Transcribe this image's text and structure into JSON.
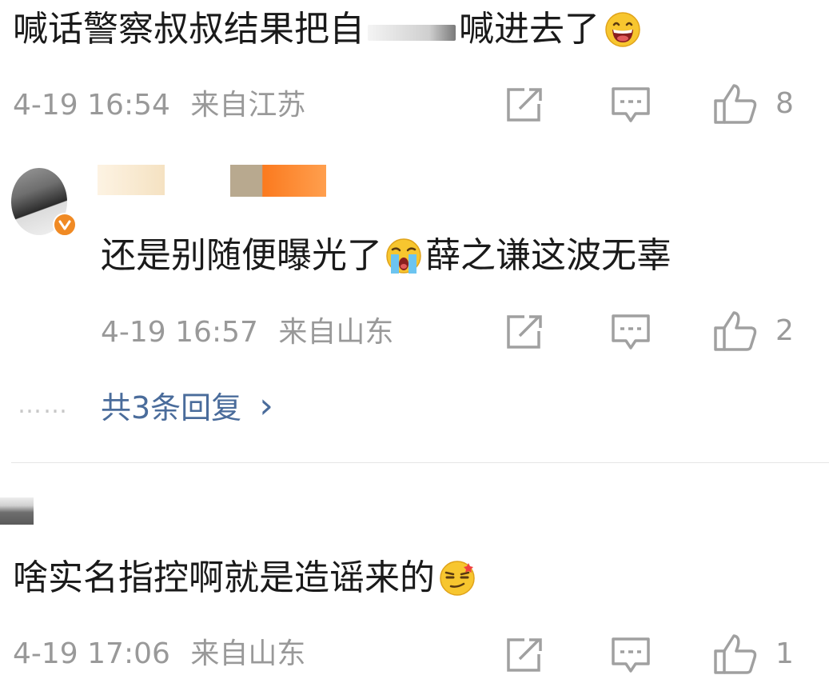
{
  "comments": [
    {
      "text_before": "喊话警察叔叔结果把自",
      "text_after": "喊进去了",
      "emoji": "grinning-face-icon",
      "time": "4-19 16:54",
      "location": "来自江苏",
      "likes": "8"
    },
    {
      "text_before": "还是别随便曝光了",
      "text_after": "薛之谦这波无辜",
      "emoji": "loudly-crying-face-icon",
      "time": "4-19 16:57",
      "location": "来自山东",
      "likes": "2",
      "replies_label": "共3条回复",
      "replies_dots": "……",
      "replies_chevron": "›"
    },
    {
      "text_before": "啥实名指控啊就是造谣来的",
      "text_after": "",
      "emoji": "smirking-face-icon",
      "time": "4-19 17:06",
      "location": "来自山东",
      "likes": "1"
    }
  ],
  "colors": {
    "text": "#1a1a1a",
    "meta": "#999999",
    "link": "#4a6c9b",
    "badge": "#f08a24",
    "divider": "#e6e6e6"
  }
}
